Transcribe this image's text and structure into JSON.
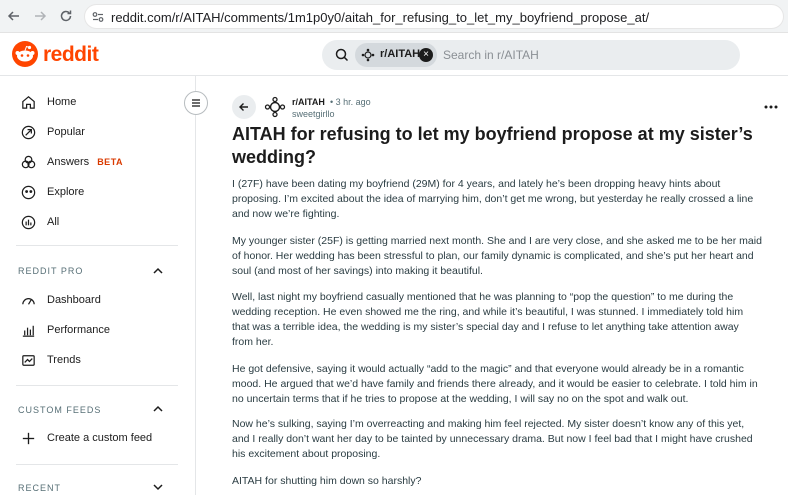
{
  "browser": {
    "url": "reddit.com/r/AITAH/comments/1m1p0y0/aitah_for_refusing_to_let_my_boyfriend_propose_at/"
  },
  "header": {
    "logo_text": "reddit",
    "search": {
      "community_chip": "r/AITAH",
      "placeholder": "Search in r/AITAH"
    }
  },
  "sidebar": {
    "main_items": [
      {
        "label": "Home",
        "icon": "home-icon"
      },
      {
        "label": "Popular",
        "icon": "popular-icon"
      },
      {
        "label": "Answers",
        "badge": "BETA",
        "icon": "answers-icon"
      },
      {
        "label": "Explore",
        "icon": "explore-icon"
      },
      {
        "label": "All",
        "icon": "all-icon"
      }
    ],
    "reddit_pro": {
      "title": "REDDIT PRO",
      "items": [
        {
          "label": "Dashboard",
          "icon": "dashboard-icon"
        },
        {
          "label": "Performance",
          "icon": "performance-icon"
        },
        {
          "label": "Trends",
          "icon": "trends-icon"
        }
      ]
    },
    "custom_feeds": {
      "title": "CUSTOM FEEDS",
      "items": [
        {
          "label": "Create a custom feed",
          "icon": "plus-icon"
        }
      ]
    },
    "recent": {
      "title": "RECENT"
    }
  },
  "post": {
    "subreddit": "r/AITAH",
    "time": "• 3 hr. ago",
    "author": "sweetgirllo",
    "title_line1": "AITAH for refusing to let my boyfriend propose at my sister’s",
    "title_line2": "wedding?",
    "paragraphs": [
      [
        "I (27F) have been dating my boyfriend (29M) for 4 years, and lately he’s been dropping heavy hints about",
        "proposing. I’m excited about the idea of marrying him, don’t get me wrong, but yesterday he really crossed a line",
        "and now we’re fighting."
      ],
      [
        "My younger sister (25F) is getting married next month. She and I are very close, and she asked me to be her maid",
        "of honor. Her wedding has been stressful to plan, our family dynamic is complicated, and she’s put her heart and",
        "soul (and most of her savings) into making it beautiful."
      ],
      [
        "Well, last night my boyfriend casually mentioned that he was planning to “pop the question” to me during the",
        "wedding reception. He even showed me the ring, and while it’s beautiful, I was stunned. I immediately told him",
        "that was a terrible idea, the wedding is my sister’s special day and I refuse to let anything take attention away",
        "from her."
      ],
      [
        "He got defensive, saying it would actually “add to the magic” and that everyone would already be in a romantic",
        "mood. He argued that we’d have family and friends there already, and it would be easier to celebrate. I told him in",
        "no uncertain terms that if he tries to propose at the wedding, I will say no on the spot and walk out."
      ],
      [
        "Now he’s sulking, saying I’m overreacting and making him feel rejected. My sister doesn’t know any of this yet,",
        "and I really don’t want her day to be tainted by unnecessary drama. But now I feel bad that I might have crushed",
        "his excitement about proposing."
      ],
      [
        "AITAH for shutting him down so harshly?"
      ]
    ]
  },
  "colors": {
    "brand": "#ff4500",
    "beta": "#d93a00",
    "search_bg": "#eaedef"
  }
}
